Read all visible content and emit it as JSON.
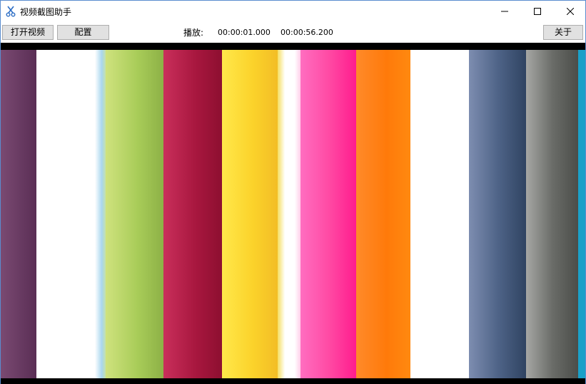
{
  "window": {
    "title": "视频截图助手",
    "controls": {
      "minimize_icon": "minimize-icon",
      "maximize_icon": "maximize-icon",
      "close_icon": "close-icon"
    }
  },
  "toolbar": {
    "open_video_label": "打开视频",
    "config_label": "配置",
    "play_label": "播放:",
    "current_time": "00:00:01.000",
    "total_time": "00:00:56.200",
    "about_label": "关于"
  },
  "video": {
    "content": "color-bars",
    "colors": {
      "purple": "#6b3a63",
      "white": "#ffffff",
      "light_blue": "#a9d6ee",
      "lime": "#a8cc58",
      "crimson": "#a8173f",
      "yellow": "#fbd22a",
      "pink": "#ff4aa4",
      "orange": "#ff7a0a",
      "slate_blue": "#4e6387",
      "gray": "#6a6c68",
      "cyan": "#1aa0c8"
    }
  }
}
